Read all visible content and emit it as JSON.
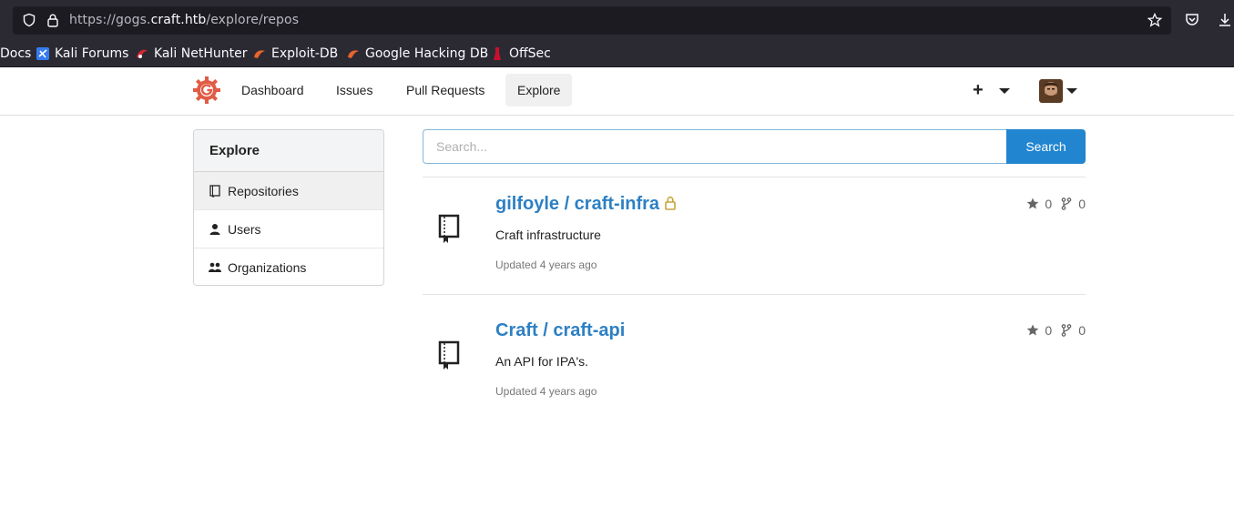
{
  "browser": {
    "url_prefix": "https://gogs.",
    "url_host": "craft.htb",
    "url_path": "/explore/repos",
    "bookmarks": [
      {
        "label": "Docs"
      },
      {
        "label": "Kali Forums"
      },
      {
        "label": "Kali NetHunter"
      },
      {
        "label": "Exploit-DB"
      },
      {
        "label": "Google Hacking DB"
      },
      {
        "label": "OffSec"
      }
    ]
  },
  "navbar": {
    "items": [
      {
        "label": "Dashboard"
      },
      {
        "label": "Issues"
      },
      {
        "label": "Pull Requests"
      },
      {
        "label": "Explore",
        "active": true
      }
    ],
    "plus_label": "+"
  },
  "sidebar": {
    "title": "Explore",
    "items": [
      {
        "label": "Repositories",
        "icon": "repo-icon",
        "active": true
      },
      {
        "label": "Users",
        "icon": "user-icon"
      },
      {
        "label": "Organizations",
        "icon": "organization-icon"
      }
    ]
  },
  "search": {
    "placeholder": "Search...",
    "value": "",
    "button_label": "Search"
  },
  "repos": [
    {
      "name": "gilfoyle / craft-infra",
      "private": true,
      "description": "Craft infrastructure",
      "updated": "Updated 4 years ago",
      "stars": "0",
      "forks": "0"
    },
    {
      "name": "Craft / craft-api",
      "private": false,
      "description": "An API for IPA's.",
      "updated": "Updated 4 years ago",
      "stars": "0",
      "forks": "0"
    }
  ],
  "colors": {
    "accent": "#2185d0",
    "link": "#2d80c4",
    "logo": "#e15b45"
  }
}
